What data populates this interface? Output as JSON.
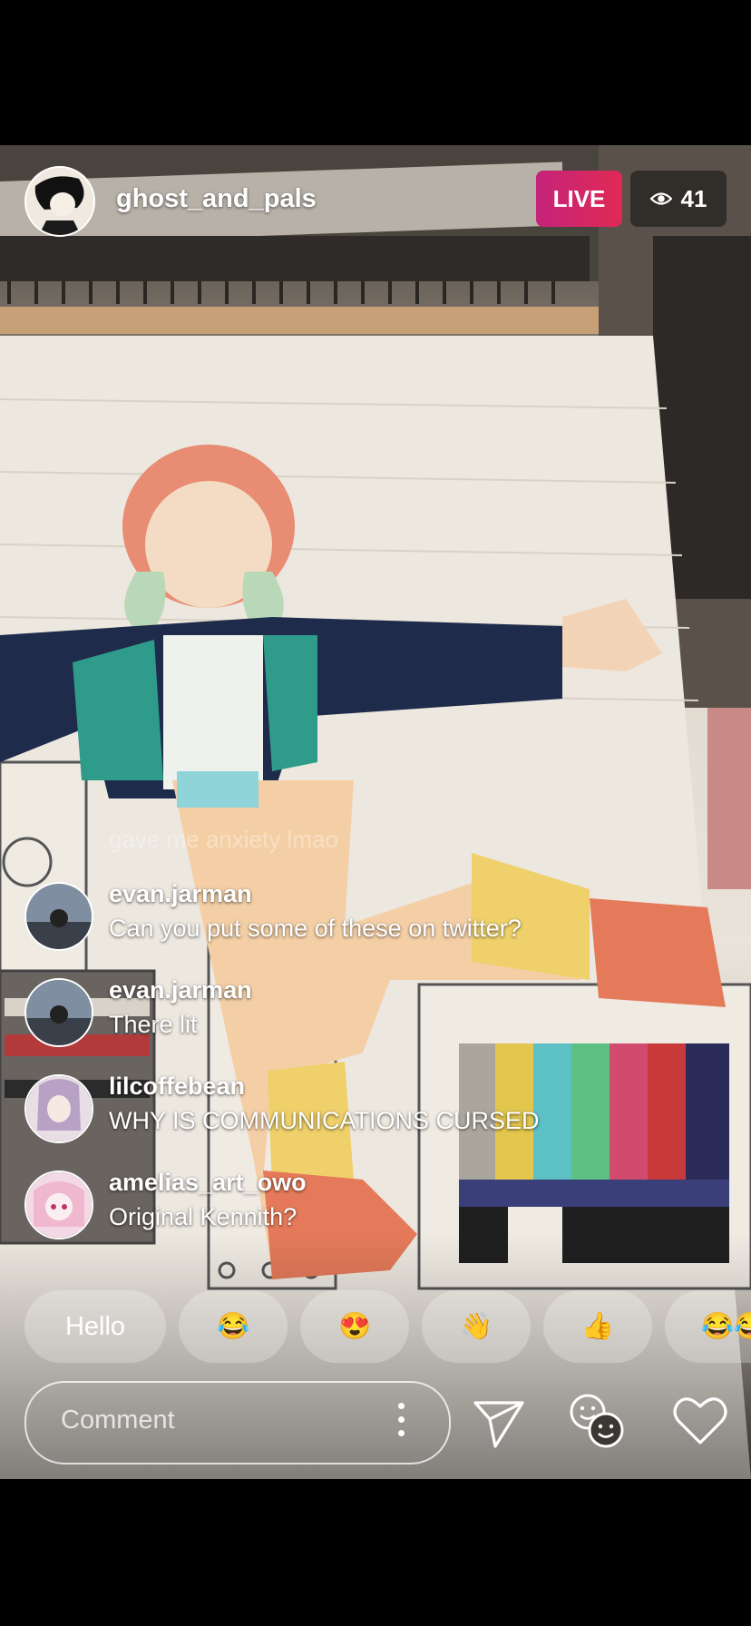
{
  "stream": {
    "host_username": "ghost_and_pals",
    "live_label": "LIVE",
    "viewer_count": "41",
    "live_color": "#d9266a"
  },
  "comments": {
    "fading_text": "gave me anxiety lmao",
    "items": [
      {
        "username": "evan.jarman",
        "text": "Can you put some of these on twitter?"
      },
      {
        "username": "evan.jarman",
        "text": "There lit"
      },
      {
        "username": "lilcoffebean",
        "text": "WHY IS COMMUNICATIONS CURSED"
      },
      {
        "username": "amelias_art_owo",
        "text": "Original Kennith?"
      }
    ]
  },
  "quick_replies": [
    "Hello",
    "😂",
    "😍",
    "👋",
    "👍",
    "😂😂"
  ],
  "comment_bar": {
    "placeholder": "Comment"
  },
  "icons": {
    "viewers": "eye-icon",
    "more": "more-vertical-icon",
    "send": "send-icon",
    "guest": "add-guest-icon",
    "like": "heart-icon"
  }
}
